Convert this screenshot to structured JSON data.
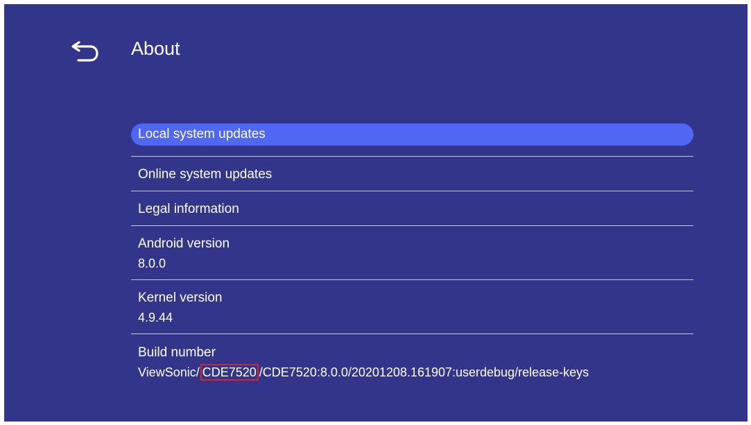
{
  "header": {
    "title": "About",
    "back_icon": "back-arrow-icon"
  },
  "menu": {
    "local_updates": "Local system updates",
    "online_updates": "Online system updates",
    "legal": "Legal information",
    "android": {
      "label": "Android version",
      "value": "8.0.0"
    },
    "kernel": {
      "label": "Kernel version",
      "value": "4.9.44"
    },
    "build": {
      "label": "Build number",
      "value_prefix": "ViewSonic/",
      "value_highlight": "CDE7520",
      "value_suffix": "/CDE7520:8.0.0/20201208.161907:userdebug/release-keys"
    }
  },
  "colors": {
    "background": "#32358a",
    "selection": "#4f67f2",
    "highlight_box": "#d8242c",
    "divider": "#c7c9e6"
  }
}
